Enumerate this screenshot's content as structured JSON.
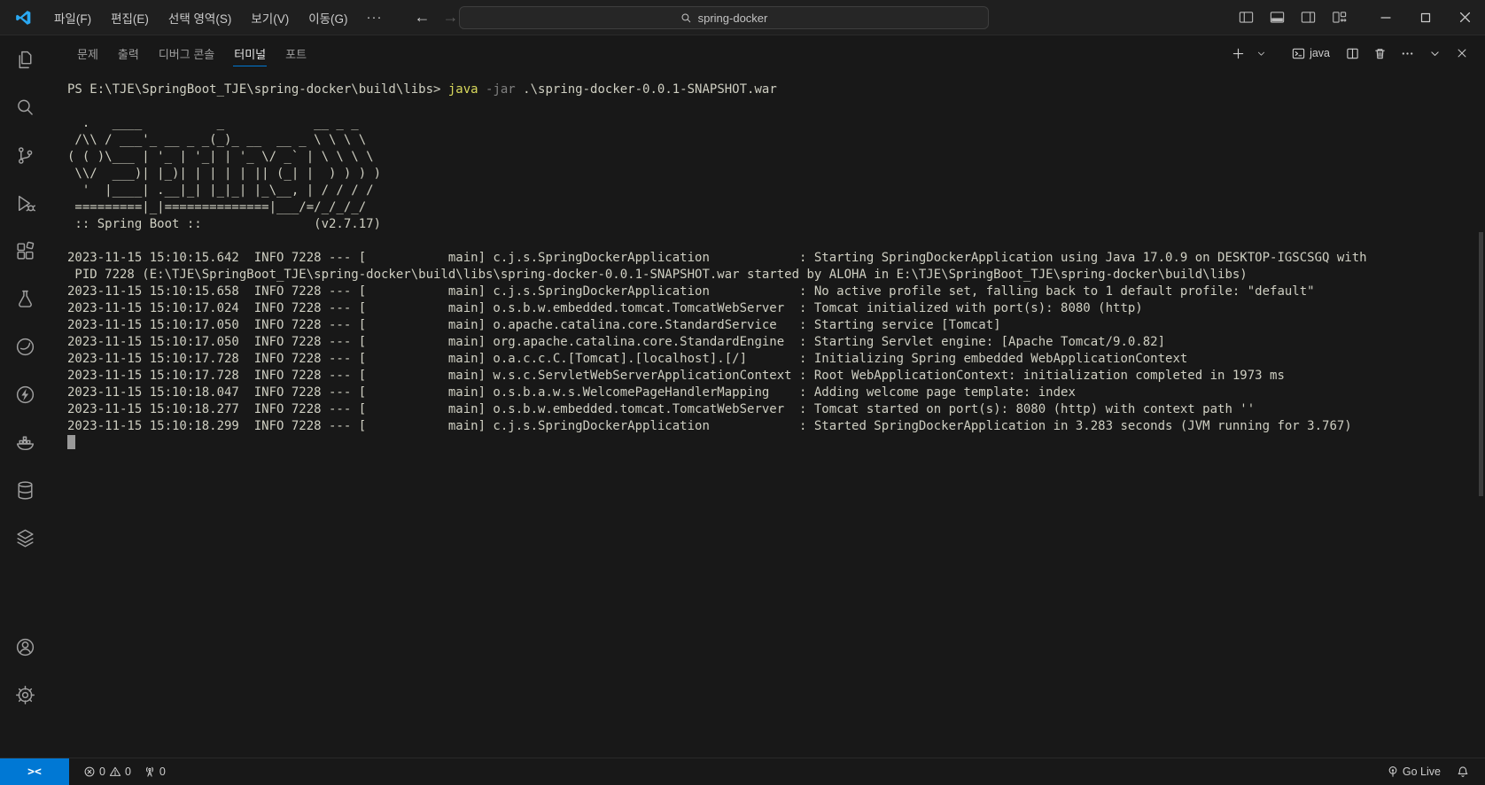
{
  "titlebar": {
    "menus": [
      "파일(F)",
      "편집(E)",
      "선택 영역(S)",
      "보기(V)",
      "이동(G)"
    ],
    "overflow": "···",
    "search_value": "spring-docker",
    "icon_names": [
      "vscode-logo-icon",
      "back-arrow-icon",
      "forward-arrow-icon",
      "search-icon",
      "toggle-primary-sidebar-icon",
      "toggle-panel-icon",
      "toggle-secondary-sidebar-icon",
      "customize-layout-icon",
      "minimize-icon",
      "maximize-icon",
      "close-icon"
    ]
  },
  "panel": {
    "tabs": [
      {
        "label": "문제"
      },
      {
        "label": "출력"
      },
      {
        "label": "디버그 콘솔"
      },
      {
        "label": "터미널",
        "active": true
      },
      {
        "label": "포트"
      }
    ],
    "actions": {
      "terminal_name": "java",
      "icon_names": [
        "new-terminal-icon",
        "launch-profile-chevron-icon",
        "terminal-icon",
        "split-terminal-icon",
        "kill-terminal-icon",
        "more-actions-icon",
        "maximize-panel-chevron-icon",
        "close-panel-icon"
      ]
    }
  },
  "activity_bar": {
    "items": [
      "explorer",
      "search",
      "source-control",
      "run-and-debug",
      "extensions",
      "testing",
      "spring-boot-dashboard",
      "thunder-client",
      "docker",
      "database",
      "layers"
    ],
    "bottom": [
      "account",
      "settings"
    ]
  },
  "terminal": {
    "prompt": {
      "ps": "PS E:\\TJE\\SpringBoot_TJE\\spring-docker\\build\\libs> ",
      "command": "java",
      "flag": " -jar",
      "argument": " .\\spring-docker-0.0.1-SNAPSHOT.war"
    },
    "banner_lines": [
      "",
      "  .   ____          _            __ _ _",
      " /\\\\ / ___'_ __ _ _(_)_ __  __ _ \\ \\ \\ \\",
      "( ( )\\___ | '_ | '_| | '_ \\/ _` | \\ \\ \\ \\",
      " \\\\/  ___)| |_)| | | | | || (_| |  ) ) ) )",
      "  '  |____| .__|_| |_|_| |_\\__, | / / / /",
      " =========|_|==============|___/=/_/_/_/",
      " :: Spring Boot ::               (v2.7.17)"
    ],
    "log_lines": [
      "2023-11-15 15:10:15.642  INFO 7228 --- [           main] c.j.s.SpringDockerApplication            : Starting SpringDockerApplication using Java 17.0.9 on DESKTOP-IGSCSGQ with",
      " PID 7228 (E:\\TJE\\SpringBoot_TJE\\spring-docker\\build\\libs\\spring-docker-0.0.1-SNAPSHOT.war started by ALOHA in E:\\TJE\\SpringBoot_TJE\\spring-docker\\build\\libs)",
      "2023-11-15 15:10:15.658  INFO 7228 --- [           main] c.j.s.SpringDockerApplication            : No active profile set, falling back to 1 default profile: \"default\"",
      "2023-11-15 15:10:17.024  INFO 7228 --- [           main] o.s.b.w.embedded.tomcat.TomcatWebServer  : Tomcat initialized with port(s): 8080 (http)",
      "2023-11-15 15:10:17.050  INFO 7228 --- [           main] o.apache.catalina.core.StandardService   : Starting service [Tomcat]",
      "2023-11-15 15:10:17.050  INFO 7228 --- [           main] org.apache.catalina.core.StandardEngine  : Starting Servlet engine: [Apache Tomcat/9.0.82]",
      "2023-11-15 15:10:17.728  INFO 7228 --- [           main] o.a.c.c.C.[Tomcat].[localhost].[/]       : Initializing Spring embedded WebApplicationContext",
      "2023-11-15 15:10:17.728  INFO 7228 --- [           main] w.s.c.ServletWebServerApplicationContext : Root WebApplicationContext: initialization completed in 1973 ms",
      "2023-11-15 15:10:18.047  INFO 7228 --- [           main] o.s.b.a.w.s.WelcomePageHandlerMapping    : Adding welcome page template: index",
      "2023-11-15 15:10:18.277  INFO 7228 --- [           main] o.s.b.w.embedded.tomcat.TomcatWebServer  : Tomcat started on port(s): 8080 (http) with context path ''",
      "2023-11-15 15:10:18.299  INFO 7228 --- [           main] c.j.s.SpringDockerApplication            : Started SpringDockerApplication in 3.283 seconds (JVM running for 3.767)"
    ]
  },
  "statusbar": {
    "remote": "><",
    "errors": "0",
    "warnings": "0",
    "ports": "0",
    "go_live": "Go Live",
    "icon_names": [
      "remote-icon",
      "error-icon",
      "warning-icon",
      "radio-tower-icon",
      "broadcast-icon",
      "bell-icon"
    ]
  },
  "colors": {
    "accent": "#0078d4",
    "remote_bg": "#0078d4",
    "terminal_fg": "#cfcfc2",
    "command_yellow": "#d9d95c"
  }
}
